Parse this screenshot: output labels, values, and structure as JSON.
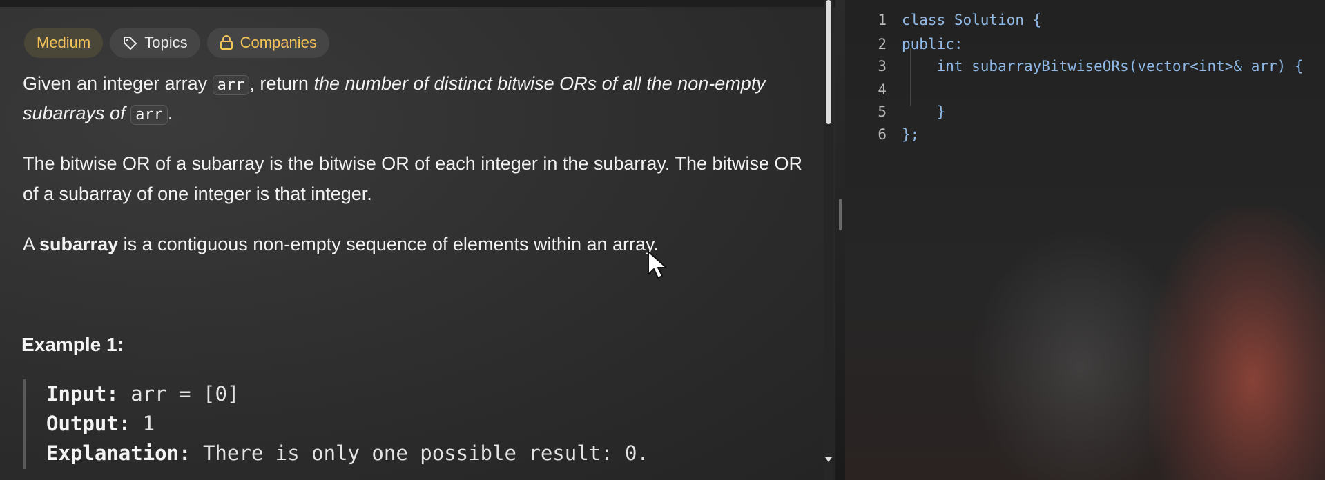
{
  "tags": {
    "difficulty": "Medium",
    "topics": "Topics",
    "companies": "Companies"
  },
  "description": {
    "p1_a": "Given an integer array ",
    "p1_code1": "arr",
    "p1_b": ", return ",
    "p1_em": "the number of distinct bitwise ORs of all the non-empty subarrays of ",
    "p1_code2": "arr",
    "p1_c": ".",
    "p2": "The bitwise OR of a subarray is the bitwise OR of each integer in the subarray. The bitwise OR of a subarray of one integer is that integer.",
    "p3_a": "A ",
    "p3_strong": "subarray",
    "p3_b": " is a contiguous non-empty sequence of elements within an array."
  },
  "example": {
    "heading": "Example 1:",
    "input_label": "Input:",
    "input_value": " arr = [0]",
    "output_label": "Output:",
    "output_value": " 1",
    "explanation_label": "Explanation:",
    "explanation_value": " There is only one possible result: 0."
  },
  "editor": {
    "lines": [
      {
        "num": "1",
        "code": "class Solution {"
      },
      {
        "num": "2",
        "code": "public:"
      },
      {
        "num": "3",
        "code": "    int subarrayBitwiseORs(vector<int>& arr) {"
      },
      {
        "num": "4",
        "code": ""
      },
      {
        "num": "5",
        "code": "    }"
      },
      {
        "num": "6",
        "code": "};"
      }
    ]
  },
  "colors": {
    "accent_yellow": "#f5c35a",
    "code_blue": "#8fb9e6"
  }
}
